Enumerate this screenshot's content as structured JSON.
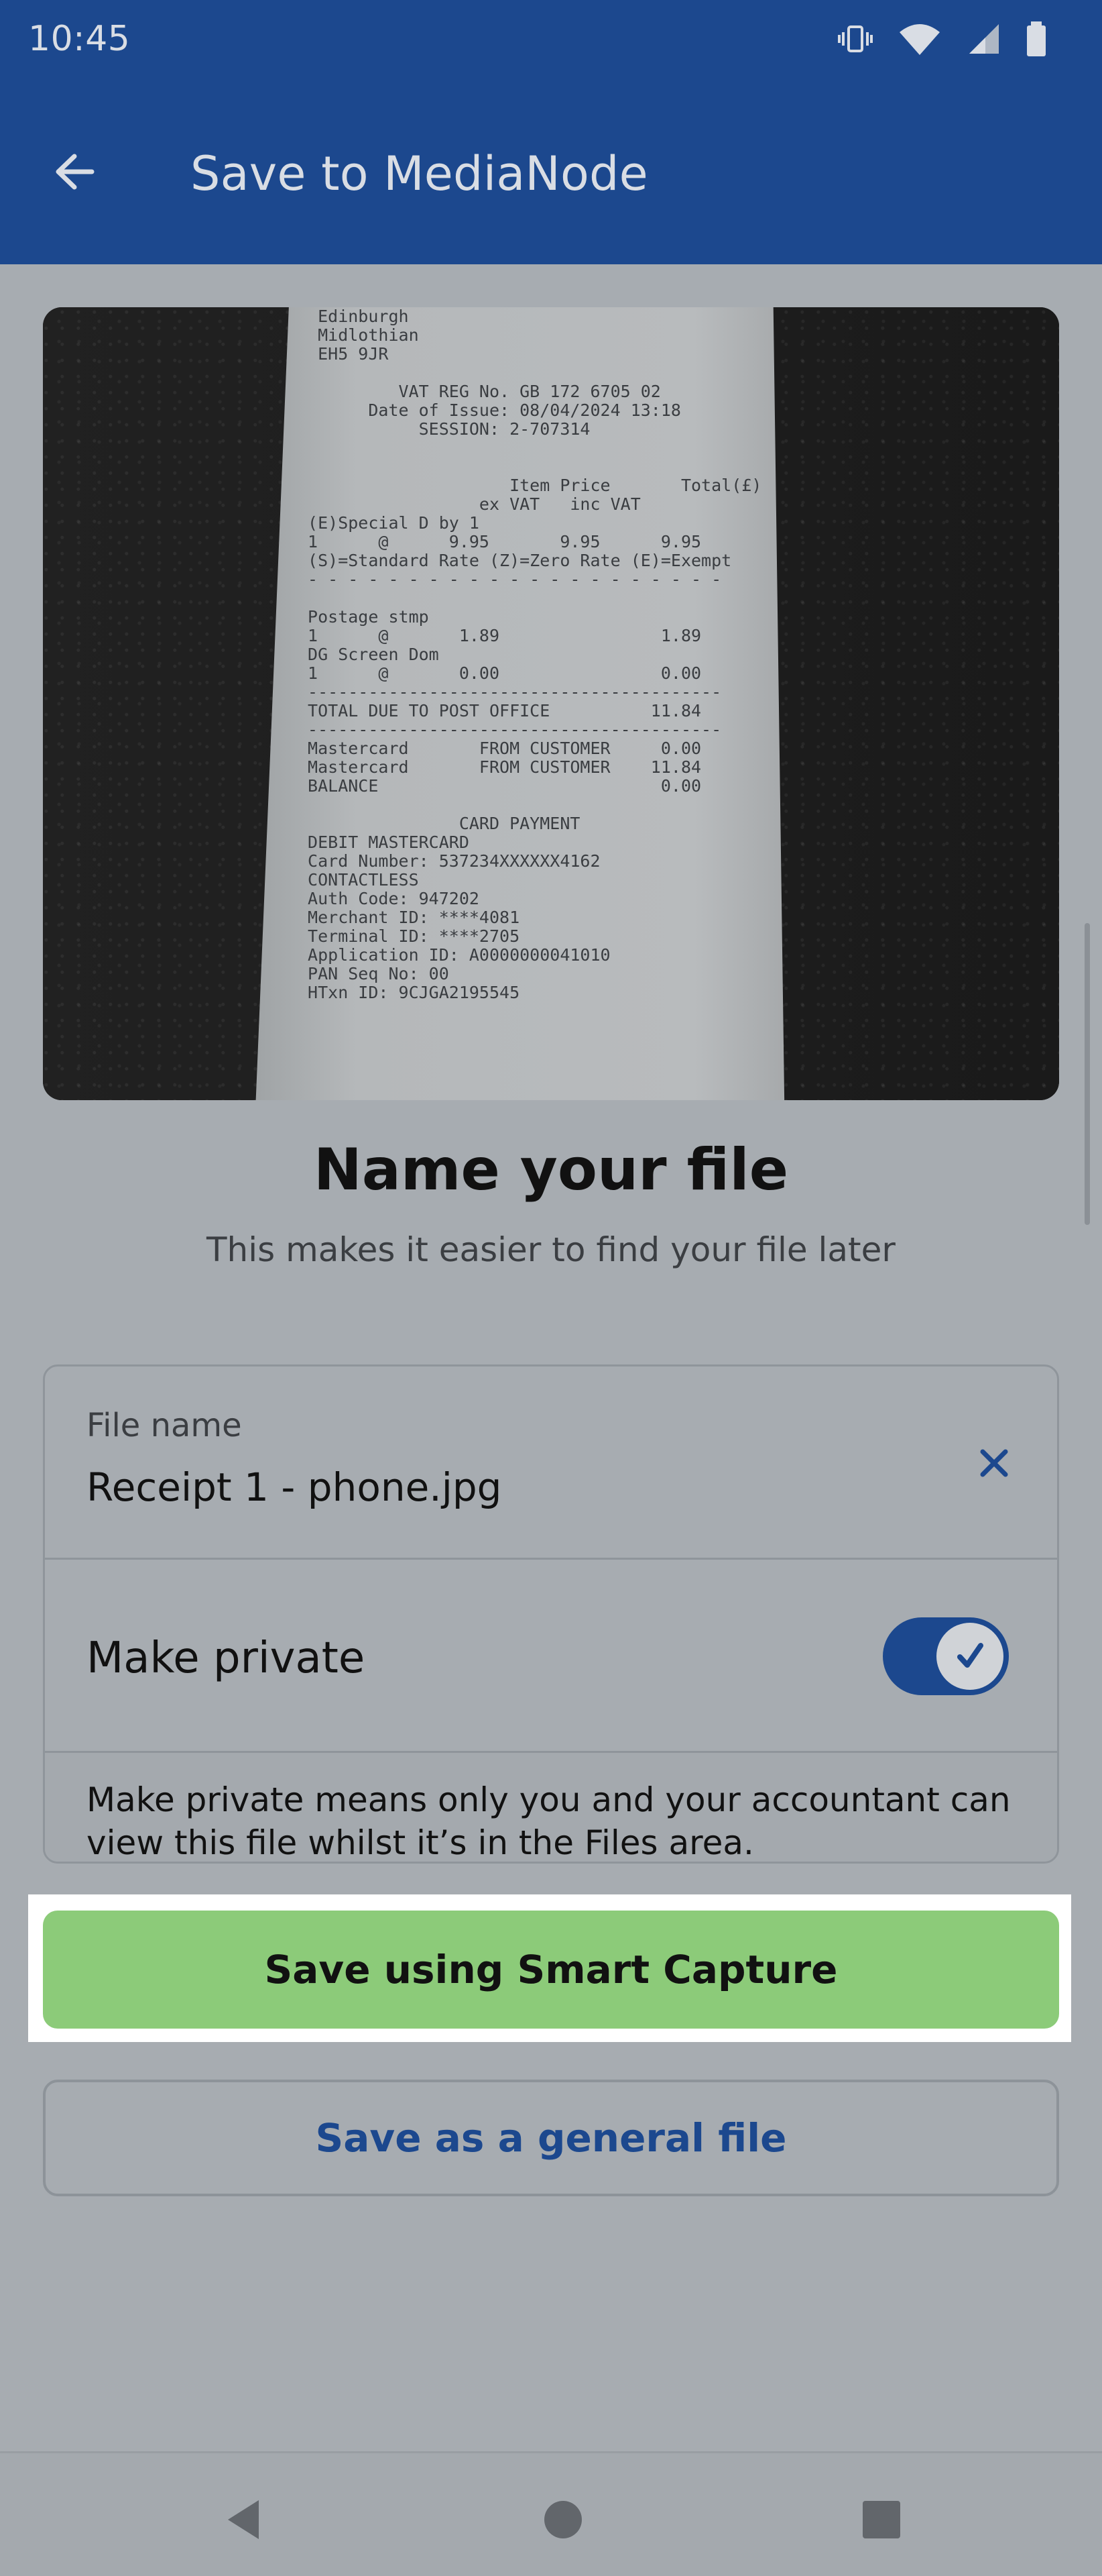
{
  "status_bar": {
    "time": "10:45",
    "icons": [
      "vibrate-icon",
      "wifi-icon",
      "signal-icon",
      "battery-icon"
    ]
  },
  "app_bar": {
    "title": "Save to MediaNode",
    "back_icon": "arrow-left-icon"
  },
  "image_preview": {
    "receipt_text": "  Edinburgh\n  Midlothian\n  EH5 9JR\n\n          VAT REG No. GB 172 6705 02\n       Date of Issue: 08/04/2024 13:18\n            SESSION: 2-707314\n\n\n                     Item Price       Total(£)\n                  ex VAT   inc VAT\n (E)Special D by 1\n 1      @      9.95       9.95      9.95\n (S)=Standard Rate (Z)=Zero Rate (E)=Exempt\n - - - - - - - - - - - - - - - - - - - - -\n\n Postage stmp\n 1      @       1.89                1.89\n DG Screen Dom\n 1      @       0.00                0.00\n -----------------------------------------\n TOTAL DUE TO POST OFFICE          11.84\n -----------------------------------------\n Mastercard       FROM CUSTOMER     0.00\n Mastercard       FROM CUSTOMER    11.84\n BALANCE                            0.00\n\n                CARD PAYMENT\n DEBIT MASTERCARD\n Card Number: 537234XXXXXX4162\n CONTACTLESS\n Auth Code: 947202\n Merchant ID: ****4081\n Terminal ID: ****2705\n Application ID: A0000000041010\n PAN Seq No: 00\n HTxn ID: 9CJGA2195545"
  },
  "main": {
    "heading": "Name your file",
    "subheading": "This makes it easier to find your file later"
  },
  "form": {
    "file_name_label": "File name",
    "file_name_value": "Receipt 1 - phone.jpg",
    "clear_icon": "close-icon",
    "make_private_label": "Make private",
    "make_private_on": true,
    "note": "Make private means only you and your accountant can view this file whilst it’s in the Files area."
  },
  "actions": {
    "primary_label": "Save using Smart Capture",
    "secondary_label": "Save as a general file"
  },
  "nav_bar": {
    "back": "nav-back-icon",
    "home": "nav-home-icon",
    "recents": "nav-recents-icon"
  },
  "colors": {
    "brand": "#1c488e",
    "primary_button": "#8ccb79",
    "overlay_gray": "#a7acb1"
  }
}
